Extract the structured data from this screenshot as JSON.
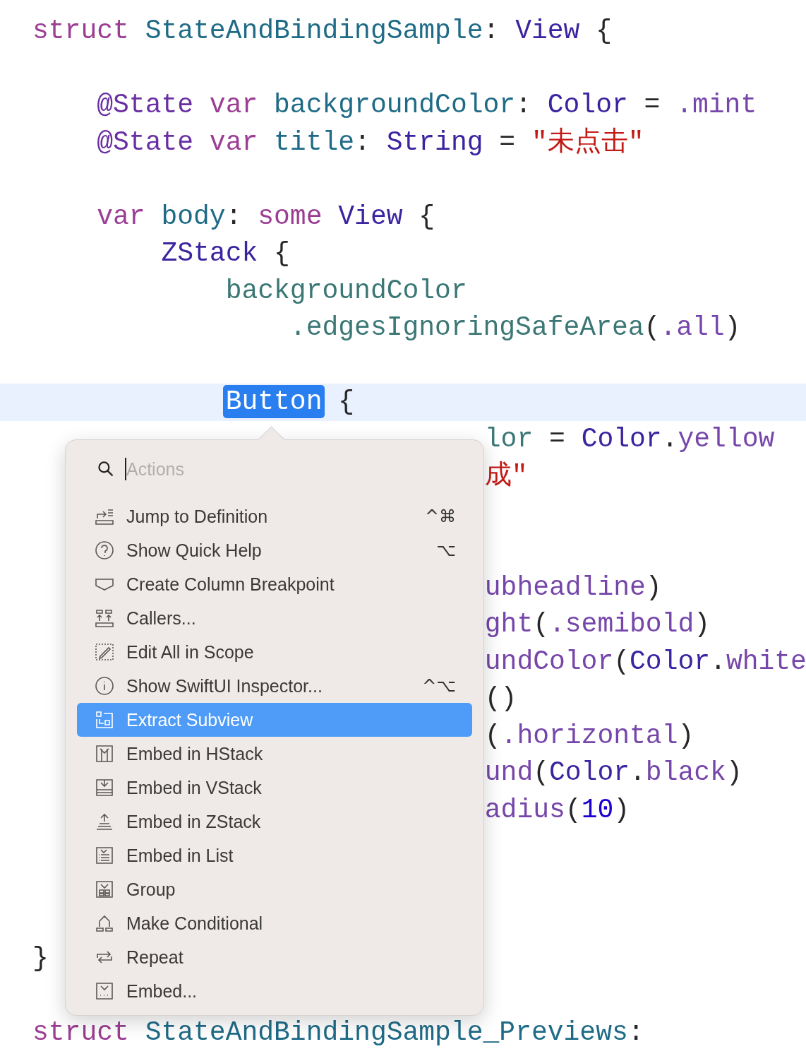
{
  "editor": {
    "lines": [
      {
        "kind": "code",
        "tokens": [
          {
            "text": "struct ",
            "kind": "keyword"
          },
          {
            "text": "StateAndBindingSample",
            "kind": "decl"
          },
          {
            "text": ": ",
            "kind": "plain"
          },
          {
            "text": "View",
            "kind": "type"
          },
          {
            "text": " {",
            "kind": "plain"
          }
        ]
      },
      {
        "kind": "blank"
      },
      {
        "kind": "code",
        "tokens": [
          {
            "text": "    @State ",
            "kind": "attribute"
          },
          {
            "text": "var ",
            "kind": "keyword"
          },
          {
            "text": "backgroundColor",
            "kind": "decl"
          },
          {
            "text": ": ",
            "kind": "plain"
          },
          {
            "text": "Color",
            "kind": "type"
          },
          {
            "text": " = ",
            "kind": "plain"
          },
          {
            "text": ".mint",
            "kind": "member"
          }
        ]
      },
      {
        "kind": "code",
        "tokens": [
          {
            "text": "    @State ",
            "kind": "attribute"
          },
          {
            "text": "var ",
            "kind": "keyword"
          },
          {
            "text": "title",
            "kind": "decl"
          },
          {
            "text": ": ",
            "kind": "plain"
          },
          {
            "text": "String",
            "kind": "type"
          },
          {
            "text": " = ",
            "kind": "plain"
          },
          {
            "text": "\"未点击\"",
            "kind": "string"
          }
        ]
      },
      {
        "kind": "blank"
      },
      {
        "kind": "code",
        "tokens": [
          {
            "text": "    var ",
            "kind": "keyword"
          },
          {
            "text": "body",
            "kind": "decl"
          },
          {
            "text": ": ",
            "kind": "plain"
          },
          {
            "text": "some ",
            "kind": "keyword"
          },
          {
            "text": "View",
            "kind": "type"
          },
          {
            "text": " {",
            "kind": "plain"
          }
        ]
      },
      {
        "kind": "code",
        "tokens": [
          {
            "text": "        ZStack",
            "kind": "type"
          },
          {
            "text": " {",
            "kind": "plain"
          }
        ]
      },
      {
        "kind": "code",
        "tokens": [
          {
            "text": "            backgroundColor",
            "kind": "ident"
          }
        ]
      },
      {
        "kind": "code",
        "tokens": [
          {
            "text": "                .edgesIgnoringSafeArea",
            "kind": "ident"
          },
          {
            "text": "(",
            "kind": "plain"
          },
          {
            "text": ".all",
            "kind": "member"
          },
          {
            "text": ")",
            "kind": "plain"
          }
        ]
      },
      {
        "kind": "blank"
      },
      {
        "kind": "indented",
        "current": true,
        "tokens": [
          {
            "text": "Button",
            "kind": "selected"
          },
          {
            "text": " {",
            "kind": "plain"
          }
        ]
      },
      {
        "kind": "partial",
        "tokens": [
          {
            "text": "lor",
            "kind": "ident"
          },
          {
            "text": " = ",
            "kind": "plain"
          },
          {
            "text": "Color",
            "kind": "type"
          },
          {
            "text": ".",
            "kind": "plain"
          },
          {
            "text": "yellow",
            "kind": "member"
          }
        ]
      },
      {
        "kind": "partial",
        "tokens": [
          {
            "text": "成\"",
            "kind": "string"
          }
        ]
      },
      {
        "kind": "blank"
      },
      {
        "kind": "blank"
      },
      {
        "kind": "partial",
        "tokens": [
          {
            "text": "ubheadline",
            "kind": "member"
          },
          {
            "text": ")",
            "kind": "plain"
          }
        ]
      },
      {
        "kind": "partial",
        "tokens": [
          {
            "text": "ght",
            "kind": "member"
          },
          {
            "text": "(",
            "kind": "plain"
          },
          {
            "text": ".semibold",
            "kind": "member"
          },
          {
            "text": ")",
            "kind": "plain"
          }
        ]
      },
      {
        "kind": "partial",
        "tokens": [
          {
            "text": "undColor",
            "kind": "member"
          },
          {
            "text": "(",
            "kind": "plain"
          },
          {
            "text": "Color",
            "kind": "type"
          },
          {
            "text": ".",
            "kind": "plain"
          },
          {
            "text": "white",
            "kind": "member"
          }
        ]
      },
      {
        "kind": "partial",
        "tokens": [
          {
            "text": "()",
            "kind": "plain"
          }
        ]
      },
      {
        "kind": "partial",
        "tokens": [
          {
            "text": "(",
            "kind": "plain"
          },
          {
            "text": ".horizontal",
            "kind": "member"
          },
          {
            "text": ")",
            "kind": "plain"
          }
        ]
      },
      {
        "kind": "partial",
        "tokens": [
          {
            "text": "und",
            "kind": "member"
          },
          {
            "text": "(",
            "kind": "plain"
          },
          {
            "text": "Color",
            "kind": "type"
          },
          {
            "text": ".",
            "kind": "plain"
          },
          {
            "text": "black",
            "kind": "member"
          },
          {
            "text": ")",
            "kind": "plain"
          }
        ]
      },
      {
        "kind": "partial",
        "tokens": [
          {
            "text": "adius",
            "kind": "member"
          },
          {
            "text": "(",
            "kind": "plain"
          },
          {
            "text": "10",
            "kind": "number"
          },
          {
            "text": ")",
            "kind": "plain"
          }
        ]
      },
      {
        "kind": "blank"
      },
      {
        "kind": "blank"
      },
      {
        "kind": "blank"
      },
      {
        "kind": "code",
        "tokens": [
          {
            "text": "}",
            "kind": "plain"
          }
        ]
      },
      {
        "kind": "blank"
      },
      {
        "kind": "code",
        "tokens": [
          {
            "text": "struct ",
            "kind": "keyword"
          },
          {
            "text": "StateAndBindingSample_Previews",
            "kind": "decl"
          },
          {
            "text": ":",
            "kind": "plain"
          }
        ]
      }
    ]
  },
  "actions_menu": {
    "search": {
      "placeholder": "Actions"
    },
    "items": [
      {
        "label": "Jump to Definition",
        "shortcut": "^⌘",
        "selected": false
      },
      {
        "label": "Show Quick Help",
        "shortcut": "⌥",
        "selected": false
      },
      {
        "label": "Create Column Breakpoint",
        "selected": false
      },
      {
        "label": "Callers...",
        "selected": false
      },
      {
        "label": "Edit All in Scope",
        "selected": false
      },
      {
        "label": "Show SwiftUI Inspector...",
        "shortcut": "^⌥",
        "selected": false
      },
      {
        "label": "Extract Subview",
        "selected": true
      },
      {
        "label": "Embed in HStack",
        "selected": false
      },
      {
        "label": "Embed in VStack",
        "selected": false
      },
      {
        "label": "Embed in ZStack",
        "selected": false
      },
      {
        "label": "Embed in List",
        "selected": false
      },
      {
        "label": "Group",
        "selected": false
      },
      {
        "label": "Make Conditional",
        "selected": false
      },
      {
        "label": "Repeat",
        "selected": false
      },
      {
        "label": "Embed...",
        "selected": false
      }
    ]
  }
}
